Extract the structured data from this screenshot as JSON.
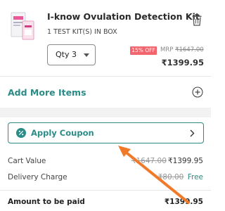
{
  "product": {
    "name": "I-know Ovulation Detection Kit",
    "subtitle": "1 TEST KIT(S) IN BOX",
    "quantity_label": "Qty 3",
    "discount": "15% OFF",
    "mrp_prefix": "MRP",
    "mrp": "₹1647.00",
    "price": "₹1399.95"
  },
  "actions": {
    "add_more_items": "Add More Items",
    "apply_coupon": "Apply Coupon"
  },
  "summary": {
    "cart_value_label": "Cart Value",
    "cart_value_original": "₹1647.00",
    "cart_value": "₹1399.95",
    "delivery_label": "Delivery Charge",
    "delivery_original": "₹80.00",
    "delivery_value": "Free",
    "total_label": "Amount to be paid",
    "total_value": "₹1399.95"
  },
  "colors": {
    "accent": "#2b8c87",
    "discount_badge": "#f2656e",
    "annotation_arrow": "#f07a2a"
  },
  "icons": [
    "product-thumbnail",
    "trash-icon",
    "chevron-down-icon",
    "plus-circle-icon",
    "percent-coupon-icon",
    "chevron-right-icon",
    "annotation-arrow"
  ]
}
